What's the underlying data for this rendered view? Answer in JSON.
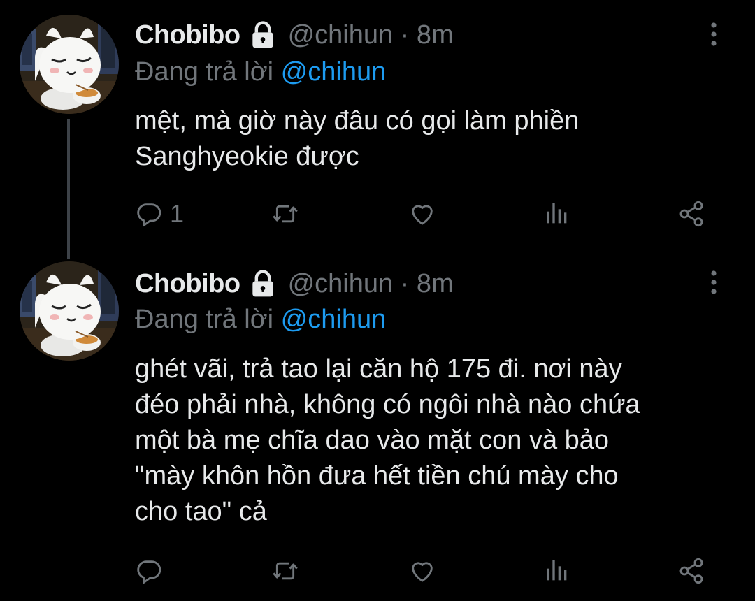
{
  "tweets": [
    {
      "display_name": "Chobibo",
      "handle": "@chihun",
      "time": "8m",
      "replying_prefix": "Đang trả lời",
      "replying_mention": "@chihun",
      "text_lines": [
        "mệt, mà giờ này đâu có gọi làm phiền",
        "Sanghyeokie được"
      ],
      "reply_count": "1",
      "retweet_count": "",
      "like_count": ""
    },
    {
      "display_name": "Chobibo",
      "handle": "@chihun",
      "time": "8m",
      "replying_prefix": "Đang trả lời",
      "replying_mention": "@chihun",
      "text_lines": [
        "ghét vãi, trả tao lại căn hộ 175 đi. nơi này",
        "đéo phải nhà, không có ngôi nhà nào chứa",
        "một bà mẹ chĩa dao vào mặt con và bảo",
        "\"mày khôn hồn đưa hết tiền chú mày cho",
        "cho tao\" cả"
      ],
      "reply_count": "",
      "retweet_count": "",
      "like_count": ""
    }
  ],
  "colors": {
    "background": "#000000",
    "primary_text": "#e7e9ea",
    "secondary_text": "#71767b",
    "accent": "#1d9bf0",
    "thread_line": "#3d4248"
  },
  "icons": {
    "protected": "lock-icon",
    "more": "more-vertical-icon",
    "reply": "reply-icon",
    "retweet": "retweet-icon",
    "like": "heart-icon",
    "analytics": "analytics-icon",
    "share": "share-icon"
  }
}
